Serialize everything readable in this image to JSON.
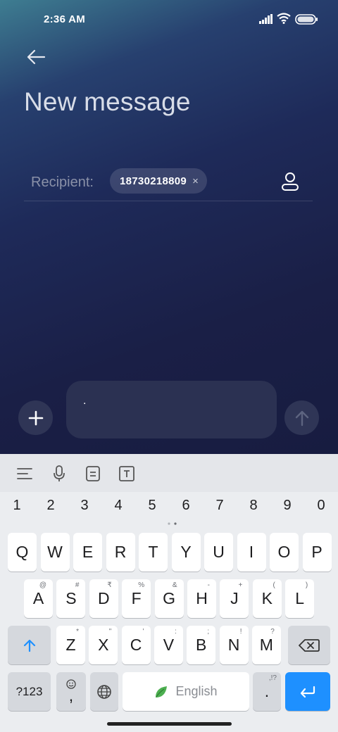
{
  "status_bar": {
    "time": "2:36 AM"
  },
  "header": {
    "title": "New message"
  },
  "recipient": {
    "label": "Recipient:",
    "chip_text": "18730218809",
    "chip_remove": "×"
  },
  "composer": {
    "text": "."
  },
  "keyboard": {
    "numbers": [
      "1",
      "2",
      "3",
      "4",
      "5",
      "6",
      "7",
      "8",
      "9",
      "0"
    ],
    "row1": [
      "Q",
      "W",
      "E",
      "R",
      "T",
      "Y",
      "U",
      "I",
      "O",
      "P"
    ],
    "row2": [
      {
        "key": "A",
        "hint": "@"
      },
      {
        "key": "S",
        "hint": "#"
      },
      {
        "key": "D",
        "hint": "₹"
      },
      {
        "key": "F",
        "hint": "%"
      },
      {
        "key": "G",
        "hint": "&"
      },
      {
        "key": "H",
        "hint": "-"
      },
      {
        "key": "J",
        "hint": "+"
      },
      {
        "key": "K",
        "hint": "("
      },
      {
        "key": "L",
        "hint": ")"
      }
    ],
    "row3": [
      {
        "key": "Z",
        "hint": "*"
      },
      {
        "key": "X",
        "hint": "\""
      },
      {
        "key": "C",
        "hint": "'"
      },
      {
        "key": "V",
        "hint": ":"
      },
      {
        "key": "B",
        "hint": ";"
      },
      {
        "key": "N",
        "hint": "!"
      },
      {
        "key": "M",
        "hint": "?"
      }
    ],
    "symbols_label": "?123",
    "comma_label": ",",
    "space_label": "English",
    "period_label": ".",
    "period_hint": ",!?",
    "accent_color": "#1e90ff"
  }
}
